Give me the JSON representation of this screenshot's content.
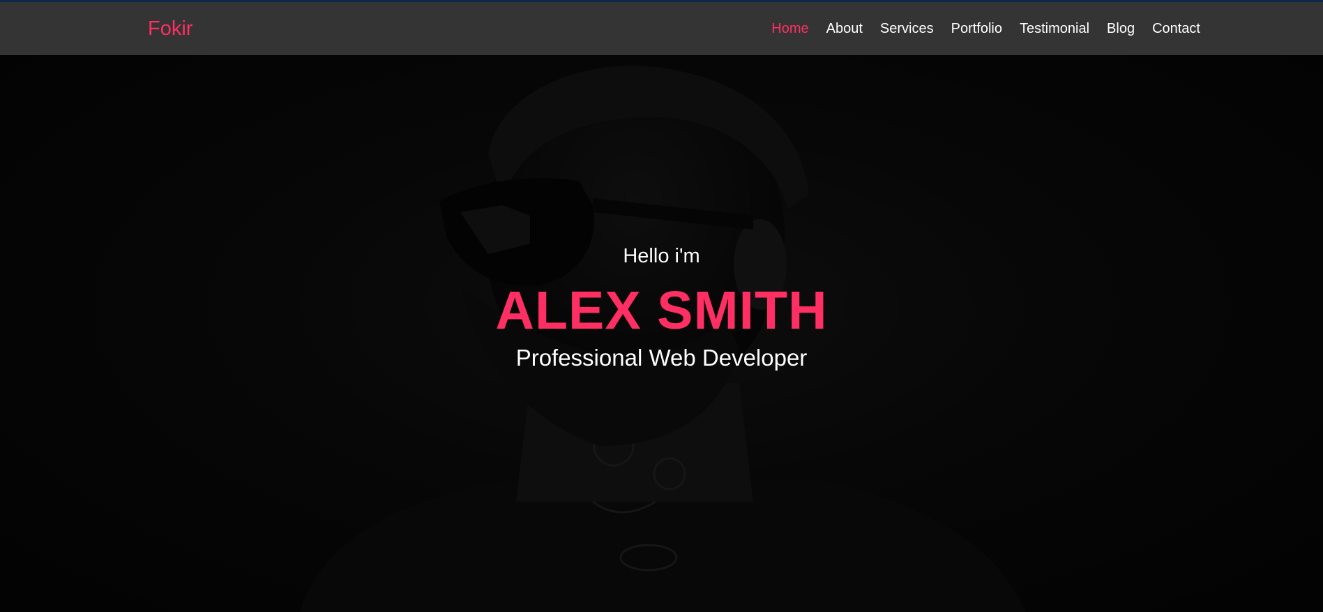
{
  "brand": {
    "name": "Fokir"
  },
  "nav": {
    "items": [
      {
        "label": "Home",
        "active": true
      },
      {
        "label": "About",
        "active": false
      },
      {
        "label": "Services",
        "active": false
      },
      {
        "label": "Portfolio",
        "active": false
      },
      {
        "label": "Testimonial",
        "active": false
      },
      {
        "label": "Blog",
        "active": false
      },
      {
        "label": "Contact",
        "active": false
      }
    ]
  },
  "hero": {
    "greeting": "Hello i'm",
    "name": "ALEX SMITH",
    "role": "Professional Web Developer",
    "background_image": "portrait-photo"
  },
  "colors": {
    "accent": "#ff2e63",
    "navbar_bg": "#343434",
    "text": "#ffffff",
    "hero_bg": "#0b0b0b"
  }
}
